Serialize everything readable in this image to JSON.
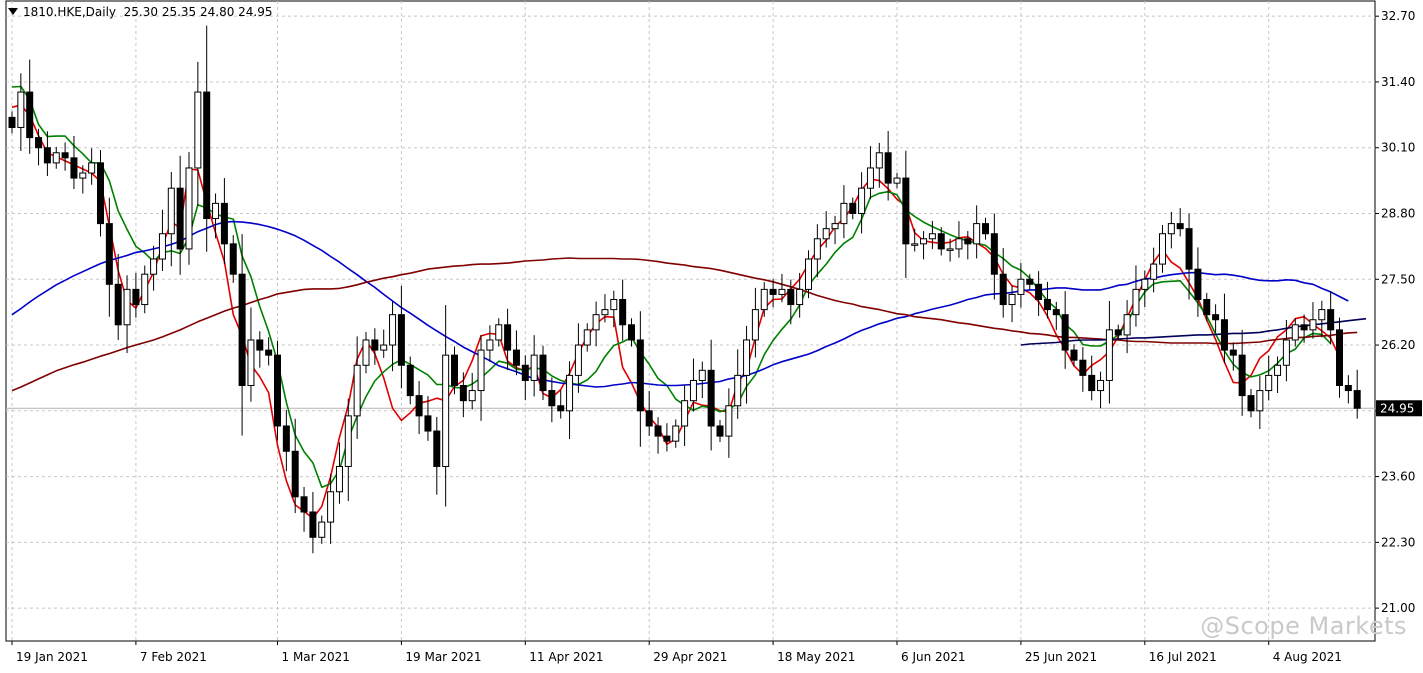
{
  "header": {
    "symbol": "1810.HKE,Daily",
    "ohlc": "25.30 25.35 24.80 24.95"
  },
  "watermark": "@Scope Markets",
  "colors": {
    "bull_body": "#ffffff",
    "bear_body": "#000000",
    "wick": "#000000",
    "ma_red": "#e00000",
    "ma_green": "#008000",
    "ma_blue": "#0000c8",
    "ma_maroon": "#800000",
    "grid": "#c8c8c8",
    "axis": "#000000"
  },
  "chart_data": {
    "type": "candlestick",
    "y_range": [
      20.35,
      33.0
    ],
    "y_ticks": [
      "32.70",
      "31.40",
      "30.10",
      "28.80",
      "27.50",
      "26.20",
      "24.90",
      "23.60",
      "22.30",
      "21.00"
    ],
    "x_ticks": [
      {
        "label": "19 Jan 2021",
        "idx": 0
      },
      {
        "label": "7 Feb 2021",
        "idx": 14
      },
      {
        "label": "1 Mar 2021",
        "idx": 30
      },
      {
        "label": "19 Mar 2021",
        "idx": 44
      },
      {
        "label": "11 Apr 2021",
        "idx": 58
      },
      {
        "label": "29 Apr 2021",
        "idx": 72
      },
      {
        "label": "18 May 2021",
        "idx": 86
      },
      {
        "label": "6 Jun 2021",
        "idx": 100
      },
      {
        "label": "25 Jun 2021",
        "idx": 114
      },
      {
        "label": "16 Jul 2021",
        "idx": 128
      },
      {
        "label": "4 Aug 2021",
        "idx": 142
      }
    ],
    "current_price": "24.95",
    "current_value": 24.95,
    "close": [
      30.5,
      31.2,
      30.3,
      30.1,
      29.8,
      30.0,
      29.9,
      29.5,
      29.6,
      29.8,
      28.6,
      27.4,
      26.6,
      27.3,
      27.0,
      27.6,
      27.9,
      28.4,
      29.3,
      28.1,
      29.7,
      31.2,
      28.7,
      29.0,
      28.2,
      27.6,
      25.4,
      26.3,
      26.1,
      26.0,
      24.6,
      24.1,
      23.2,
      22.9,
      22.4,
      22.7,
      23.3,
      23.8,
      24.8,
      25.8,
      26.3,
      26.1,
      26.2,
      26.8,
      25.8,
      25.2,
      24.8,
      24.5,
      23.8,
      26.0,
      25.4,
      25.1,
      25.3,
      26.1,
      26.3,
      26.6,
      26.1,
      25.8,
      25.5,
      26.0,
      25.3,
      25.0,
      24.9,
      25.6,
      26.2,
      26.5,
      26.8,
      26.9,
      27.1,
      26.6,
      26.3,
      24.9,
      24.6,
      24.4,
      24.3,
      24.6,
      25.1,
      25.5,
      25.7,
      24.6,
      24.4,
      25.0,
      25.6,
      26.3,
      26.9,
      27.3,
      27.2,
      27.3,
      27.0,
      27.3,
      27.9,
      28.3,
      28.5,
      28.6,
      29.0,
      28.8,
      29.3,
      29.7,
      30.0,
      29.4,
      29.5,
      28.2,
      28.2,
      28.3,
      28.4,
      28.1,
      28.1,
      28.3,
      28.2,
      28.6,
      28.4,
      27.6,
      27.0,
      27.2,
      27.5,
      27.4,
      27.1,
      26.9,
      26.8,
      26.1,
      25.9,
      25.6,
      25.3,
      25.5,
      26.5,
      26.4,
      26.8,
      27.3,
      27.5,
      27.8,
      28.4,
      28.6,
      28.5,
      27.7,
      27.1,
      26.8,
      26.7,
      26.1,
      26.0,
      25.2,
      24.9,
      25.3,
      25.6,
      25.8,
      26.3,
      26.6,
      26.5,
      26.7,
      26.9,
      26.5,
      25.4,
      25.3,
      24.95
    ],
    "series": [
      {
        "name": "MA red",
        "color": "#e00000",
        "values": [
          30.9,
          30.94,
          30.74,
          30.34,
          30.0,
          29.92,
          29.84,
          29.76,
          29.68,
          29.6,
          29.43,
          28.56,
          27.67,
          27.08,
          26.93,
          27.29,
          27.64,
          28.17,
          28.63,
          28.52,
          29.68,
          29.66,
          29.02,
          28.42,
          27.85,
          26.8,
          26.38,
          25.81,
          25.57,
          25.26,
          24.22,
          23.52,
          23.04,
          22.91,
          22.78,
          23.01,
          23.6,
          24.37,
          25.01,
          25.92,
          26.29,
          26.03,
          25.55,
          24.95,
          24.71,
          24.86,
          25.05,
          25.09,
          25.15,
          25.1,
          25.38,
          25.5,
          25.89,
          26.38,
          26.43,
          26.41,
          25.88,
          25.75,
          25.69,
          25.79,
          25.24,
          25.16,
          25.32,
          25.64,
          26.04,
          26.37,
          26.62,
          26.76,
          26.75,
          25.76,
          25.45,
          25.07,
          24.78,
          24.58,
          24.24,
          24.34,
          24.7,
          25.07,
          25.01,
          24.99,
          24.9,
          24.88,
          25.44,
          25.71,
          26.34,
          26.93,
          27.1,
          27.11,
          27.31,
          27.5,
          27.8,
          28.08,
          28.27,
          28.54,
          28.7,
          28.94,
          29.27,
          29.48,
          29.45,
          29.29,
          29.08,
          28.95,
          28.42,
          28.26,
          28.23,
          28.21,
          28.23,
          28.32,
          28.34,
          28.22,
          28.11,
          27.93,
          27.6,
          27.37,
          27.33,
          27.23,
          27.06,
          26.77,
          26.4,
          26.12,
          25.79,
          25.62,
          25.8,
          25.91,
          26.07,
          26.37,
          26.74,
          27.13,
          27.49,
          27.84,
          28.08,
          27.84,
          27.72,
          27.43,
          27.13,
          26.69,
          26.31,
          25.86,
          25.46,
          25.45,
          25.6,
          25.94,
          26.09,
          26.36,
          26.5,
          26.72,
          26.76,
          26.61,
          26.48,
          26.34,
          25.96
        ]
      },
      {
        "name": "MA green",
        "color": "#008000",
        "values": [
          31.3,
          31.31,
          31.05,
          30.56,
          30.32,
          30.33,
          30.33,
          30.14,
          29.98,
          29.8,
          29.8,
          29.45,
          28.85,
          28.49,
          28.15,
          28.02,
          27.85,
          28.03,
          28.06,
          28.01,
          28.33,
          28.97,
          28.91,
          28.79,
          28.73,
          28.69,
          27.96,
          27.55,
          26.96,
          26.47,
          25.87,
          25.07,
          24.42,
          24.09,
          23.87,
          23.39,
          23.46,
          23.73,
          24.35,
          24.79,
          25.18,
          25.49,
          25.67,
          25.82,
          25.91,
          25.82,
          25.71,
          25.61,
          25.42,
          25.42,
          25.36,
          25.35,
          25.43,
          25.55,
          25.71,
          25.88,
          25.84,
          25.72,
          25.71,
          25.75,
          25.72,
          25.59,
          25.5,
          25.45,
          25.42,
          25.51,
          25.68,
          25.97,
          26.19,
          26.26,
          26.35,
          26.06,
          25.82,
          25.54,
          25.4,
          25.13,
          25.01,
          24.91,
          24.99,
          24.96,
          24.88,
          24.94,
          25.04,
          25.38,
          25.61,
          26.01,
          26.29,
          26.51,
          26.71,
          26.99,
          27.38,
          27.6,
          27.8,
          28.03,
          28.21,
          28.33,
          28.69,
          29.12,
          29.2,
          29.23,
          29.17,
          28.87,
          28.74,
          28.63,
          28.54,
          28.46,
          28.38,
          28.31,
          28.26,
          28.21,
          28.17,
          28.03,
          27.91,
          27.76,
          27.68,
          27.52,
          27.3,
          27.07,
          26.92,
          26.61,
          26.46,
          26.21,
          26.18,
          26.18,
          26.28,
          26.4,
          26.64,
          26.98,
          27.25,
          27.41,
          27.45,
          27.46,
          27.47,
          27.26,
          27.03,
          26.77,
          26.42,
          26.08,
          25.82,
          25.66,
          25.57,
          25.61,
          25.69,
          25.84,
          26.03,
          26.12,
          26.34,
          26.43,
          26.41,
          26.23
        ]
      },
      {
        "name": "MA blue",
        "color": "#0000c8",
        "values": [
          26.8,
          26.92,
          27.05,
          27.17,
          27.28,
          27.39,
          27.48,
          27.57,
          27.65,
          27.73,
          27.81,
          27.87,
          27.92,
          27.97,
          28.03,
          28.06,
          28.1,
          28.14,
          28.19,
          28.25,
          28.35,
          28.44,
          28.51,
          28.58,
          28.63,
          28.64,
          28.63,
          28.61,
          28.58,
          28.54,
          28.49,
          28.43,
          28.36,
          28.27,
          28.17,
          28.07,
          27.95,
          27.84,
          27.71,
          27.59,
          27.46,
          27.34,
          27.2,
          27.07,
          26.94,
          26.83,
          26.71,
          26.59,
          26.48,
          26.37,
          26.27,
          26.16,
          26.07,
          25.98,
          25.89,
          25.79,
          25.73,
          25.67,
          25.6,
          25.53,
          25.51,
          25.48,
          25.45,
          25.43,
          25.41,
          25.39,
          25.37,
          25.38,
          25.41,
          25.43,
          25.46,
          25.45,
          25.43,
          25.41,
          25.4,
          25.4,
          25.41,
          25.42,
          25.44,
          25.46,
          25.48,
          25.53,
          25.56,
          25.6,
          25.66,
          25.73,
          25.81,
          25.87,
          25.92,
          25.97,
          26.02,
          26.09,
          26.17,
          26.24,
          26.32,
          26.41,
          26.49,
          26.55,
          26.62,
          26.67,
          26.73,
          26.76,
          26.82,
          26.86,
          26.91,
          26.95,
          26.99,
          27.04,
          27.1,
          27.14,
          27.19,
          27.21,
          27.22,
          27.24,
          27.27,
          27.29,
          27.29,
          27.31,
          27.33,
          27.33,
          27.31,
          27.29,
          27.29,
          27.29,
          27.33,
          27.38,
          27.4,
          27.46,
          27.51,
          27.52,
          27.56,
          27.59,
          27.61,
          27.63,
          27.63,
          27.61,
          27.59,
          27.6,
          27.58,
          27.55,
          27.51,
          27.48,
          27.47,
          27.47,
          27.49,
          27.48,
          27.43,
          27.4,
          27.32,
          27.25,
          27.16,
          27.07
        ]
      },
      {
        "name": "MA maroon",
        "color": "#800000",
        "values": [
          25.3,
          25.37,
          25.45,
          25.53,
          25.61,
          25.69,
          25.75,
          25.81,
          25.86,
          25.92,
          25.98,
          26.03,
          26.09,
          26.15,
          26.2,
          26.25,
          26.3,
          26.36,
          26.43,
          26.5,
          26.58,
          26.66,
          26.73,
          26.8,
          26.87,
          26.93,
          26.98,
          27.04,
          27.1,
          27.15,
          27.21,
          27.24,
          27.27,
          27.3,
          27.31,
          27.31,
          27.31,
          27.32,
          27.35,
          27.39,
          27.44,
          27.48,
          27.52,
          27.55,
          27.59,
          27.62,
          27.66,
          27.7,
          27.72,
          27.74,
          27.76,
          27.77,
          27.79,
          27.8,
          27.8,
          27.81,
          27.82,
          27.84,
          27.86,
          27.87,
          27.88,
          27.9,
          27.91,
          27.92,
          27.91,
          27.91,
          27.91,
          27.91,
          27.91,
          27.9,
          27.9,
          27.89,
          27.87,
          27.85,
          27.82,
          27.8,
          27.78,
          27.75,
          27.73,
          27.71,
          27.68,
          27.64,
          27.6,
          27.56,
          27.52,
          27.49,
          27.45,
          27.4,
          27.35,
          27.3,
          27.24,
          27.18,
          27.13,
          27.08,
          27.04,
          27.01,
          26.96,
          26.93,
          26.9,
          26.86,
          26.82,
          26.8,
          26.76,
          26.74,
          26.72,
          26.7,
          26.67,
          26.64,
          26.62,
          26.59,
          26.56,
          26.53,
          26.51,
          26.48,
          26.46,
          26.43,
          26.42,
          26.4,
          26.37,
          26.35,
          26.35,
          26.34,
          26.33,
          26.32,
          26.3,
          26.3,
          26.28,
          26.27,
          26.27,
          26.26,
          26.25,
          26.24,
          26.24,
          26.24,
          26.24,
          26.24,
          26.23,
          26.23,
          26.23,
          26.24,
          26.25,
          26.26,
          26.29,
          26.31,
          26.33,
          26.35,
          26.35,
          26.37,
          26.38,
          26.39,
          26.42,
          26.44,
          26.45
        ]
      },
      {
        "name": "MA navy",
        "color": "#00005a",
        "start_idx": 114,
        "values": [
          26.2,
          26.22,
          26.23,
          26.24,
          26.25,
          26.27,
          26.29,
          26.3,
          26.3,
          26.3,
          26.31,
          26.32,
          26.33,
          26.34,
          26.34,
          26.35,
          26.36,
          26.37,
          26.38,
          26.39,
          26.4,
          26.4,
          26.41,
          26.42,
          26.43,
          26.43,
          26.44,
          26.45,
          26.48,
          26.5,
          26.53,
          26.56,
          26.58,
          26.6,
          26.62,
          26.64,
          26.66,
          26.68,
          26.7,
          26.72
        ]
      }
    ]
  }
}
